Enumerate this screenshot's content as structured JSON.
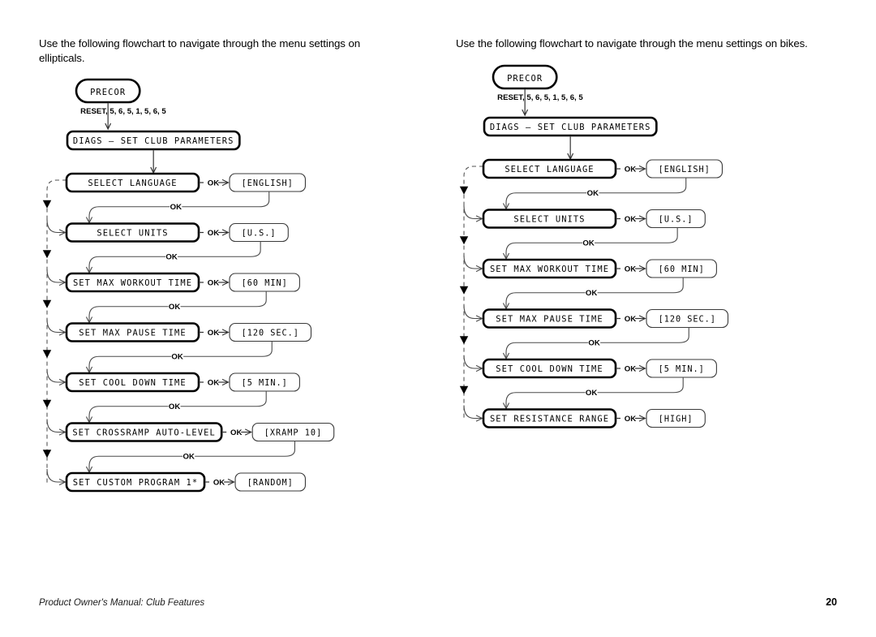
{
  "document": {
    "footer_text": "Product Owner's Manual: Club Features",
    "page_number": "20"
  },
  "columns": [
    {
      "id": "ellipticals",
      "intro": "Use the following flowchart to navigate through the menu settings on ellipticals.",
      "start_label": "PRECOR",
      "key_sequence": "RESET, 5, 6, 5, 1, 5, 6, 5",
      "diags_label": "DIAGS – SET CLUB PARAMETERS",
      "ok_label": "OK",
      "rows": [
        {
          "menu": "SELECT LANGUAGE",
          "value": "[ENGLISH]"
        },
        {
          "menu": "SELECT UNITS",
          "value": "[U.S.]"
        },
        {
          "menu": "SET MAX WORKOUT TIME",
          "value": "[60 MIN]"
        },
        {
          "menu": "SET MAX PAUSE TIME",
          "value": "[120 SEC.]"
        },
        {
          "menu": "SET COOL DOWN TIME",
          "value": "[5 MIN.]"
        },
        {
          "menu": "SET CROSSRAMP AUTO-LEVEL",
          "value": "[XRAMP 10]"
        },
        {
          "menu": "SET CUSTOM PROGRAM 1*",
          "value": "[RANDOM]"
        }
      ]
    },
    {
      "id": "bikes",
      "intro": "Use the following flowchart to navigate through the menu settings on bikes.",
      "start_label": "PRECOR",
      "key_sequence": "RESET, 5, 6, 5, 1, 5, 6, 5",
      "diags_label": "DIAGS – SET CLUB PARAMETERS",
      "ok_label": "OK",
      "rows": [
        {
          "menu": "SELECT LANGUAGE",
          "value": "[ENGLISH]"
        },
        {
          "menu": "SELECT UNITS",
          "value": "[U.S.]"
        },
        {
          "menu": "SET MAX WORKOUT TIME",
          "value": "[60 MIN]"
        },
        {
          "menu": "SET MAX PAUSE TIME",
          "value": "[120 SEC.]"
        },
        {
          "menu": "SET COOL DOWN TIME",
          "value": "[5 MIN.]"
        },
        {
          "menu": "SET RESISTANCE RANGE",
          "value": "[HIGH]"
        }
      ]
    }
  ],
  "colors": {
    "ink": "#000000",
    "connector": "#4a4a4a",
    "rail": "#555555",
    "paper": "#ffffff"
  }
}
